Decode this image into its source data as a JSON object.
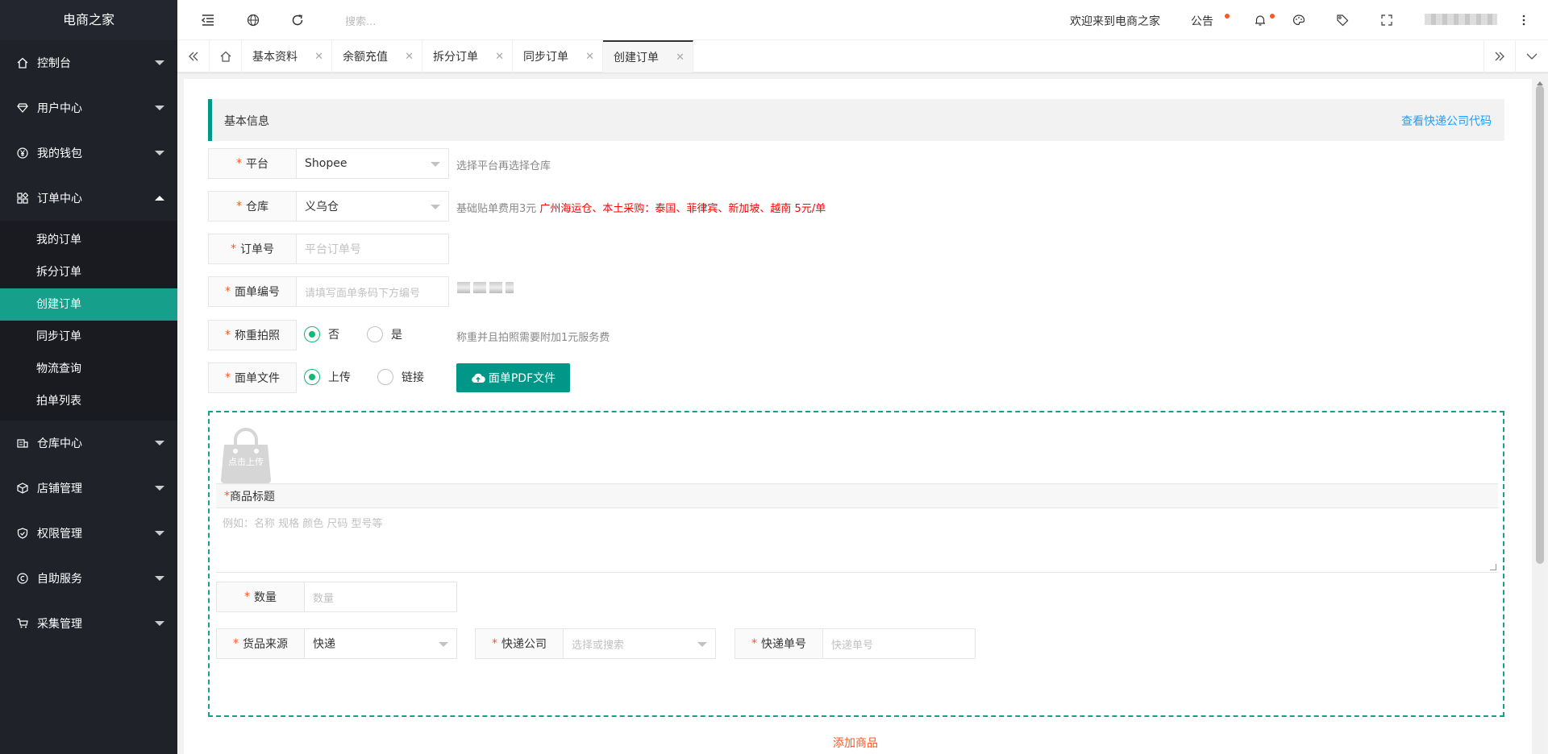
{
  "app": {
    "title": "电商之家"
  },
  "sidebar": {
    "items": [
      {
        "label": "控制台",
        "icon": "home-icon"
      },
      {
        "label": "用户中心",
        "icon": "diamond-icon"
      },
      {
        "label": "我的钱包",
        "icon": "yen-icon"
      },
      {
        "label": "订单中心",
        "icon": "apps-icon",
        "expanded": true
      },
      {
        "label": "仓库中心",
        "icon": "warehouse-icon"
      },
      {
        "label": "店铺管理",
        "icon": "box-icon"
      },
      {
        "label": "权限管理",
        "icon": "shield-icon"
      },
      {
        "label": "自助服务",
        "icon": "service-icon"
      },
      {
        "label": "采集管理",
        "icon": "cart-icon"
      }
    ],
    "order_sub": [
      {
        "label": "我的订单"
      },
      {
        "label": "拆分订单"
      },
      {
        "label": "创建订单",
        "active": true
      },
      {
        "label": "同步订单"
      },
      {
        "label": "物流查询"
      },
      {
        "label": "拍单列表"
      }
    ]
  },
  "header": {
    "search_placeholder": "搜索...",
    "welcome": "欢迎来到电商之家",
    "notice": "公告"
  },
  "tabs": [
    {
      "label": "基本资料"
    },
    {
      "label": "余额充值"
    },
    {
      "label": "拆分订单"
    },
    {
      "label": "同步订单"
    },
    {
      "label": "创建订单",
      "active": true
    }
  ],
  "form": {
    "section_title": "基本信息",
    "courier_code_link": "查看快递公司代码",
    "platform": {
      "label": "平台",
      "value": "Shopee",
      "hint": "选择平台再选择仓库"
    },
    "warehouse": {
      "label": "仓库",
      "value": "义乌仓",
      "hint_gray": "基础贴单费用3元",
      "hint_red": "广州海运仓、本土采购：泰国、菲律宾、新加坡、越南 5元/单"
    },
    "order_no": {
      "label": "订单号",
      "placeholder": "平台订单号"
    },
    "waybill_no": {
      "label": "面单编号",
      "placeholder": "请填写面单条码下方编号"
    },
    "weigh_photo": {
      "label": "称重拍照",
      "options": [
        "否",
        "是"
      ],
      "selected": "否",
      "hint": "称重并且拍照需要附加1元服务费"
    },
    "waybill_file": {
      "label": "面单文件",
      "options": [
        "上传",
        "链接"
      ],
      "selected": "上传",
      "button": "面单PDF文件"
    }
  },
  "goods": {
    "upload_text": "点击上传",
    "title_label": "商品标题",
    "title_placeholder": "例如：名称 规格 颜色 尺码 型号等",
    "quantity": {
      "label": "数量",
      "placeholder": "数量"
    },
    "source": {
      "label": "货品来源",
      "value": "快递"
    },
    "courier": {
      "label": "快递公司",
      "placeholder": "选择或搜索"
    },
    "tracking": {
      "label": "快递单号",
      "placeholder": "快递单号"
    },
    "add_button": "添加商品"
  },
  "colors": {
    "accent": "#009688",
    "active_menu": "#16a08c",
    "required": "#ff5722",
    "link": "#1e9fff"
  }
}
